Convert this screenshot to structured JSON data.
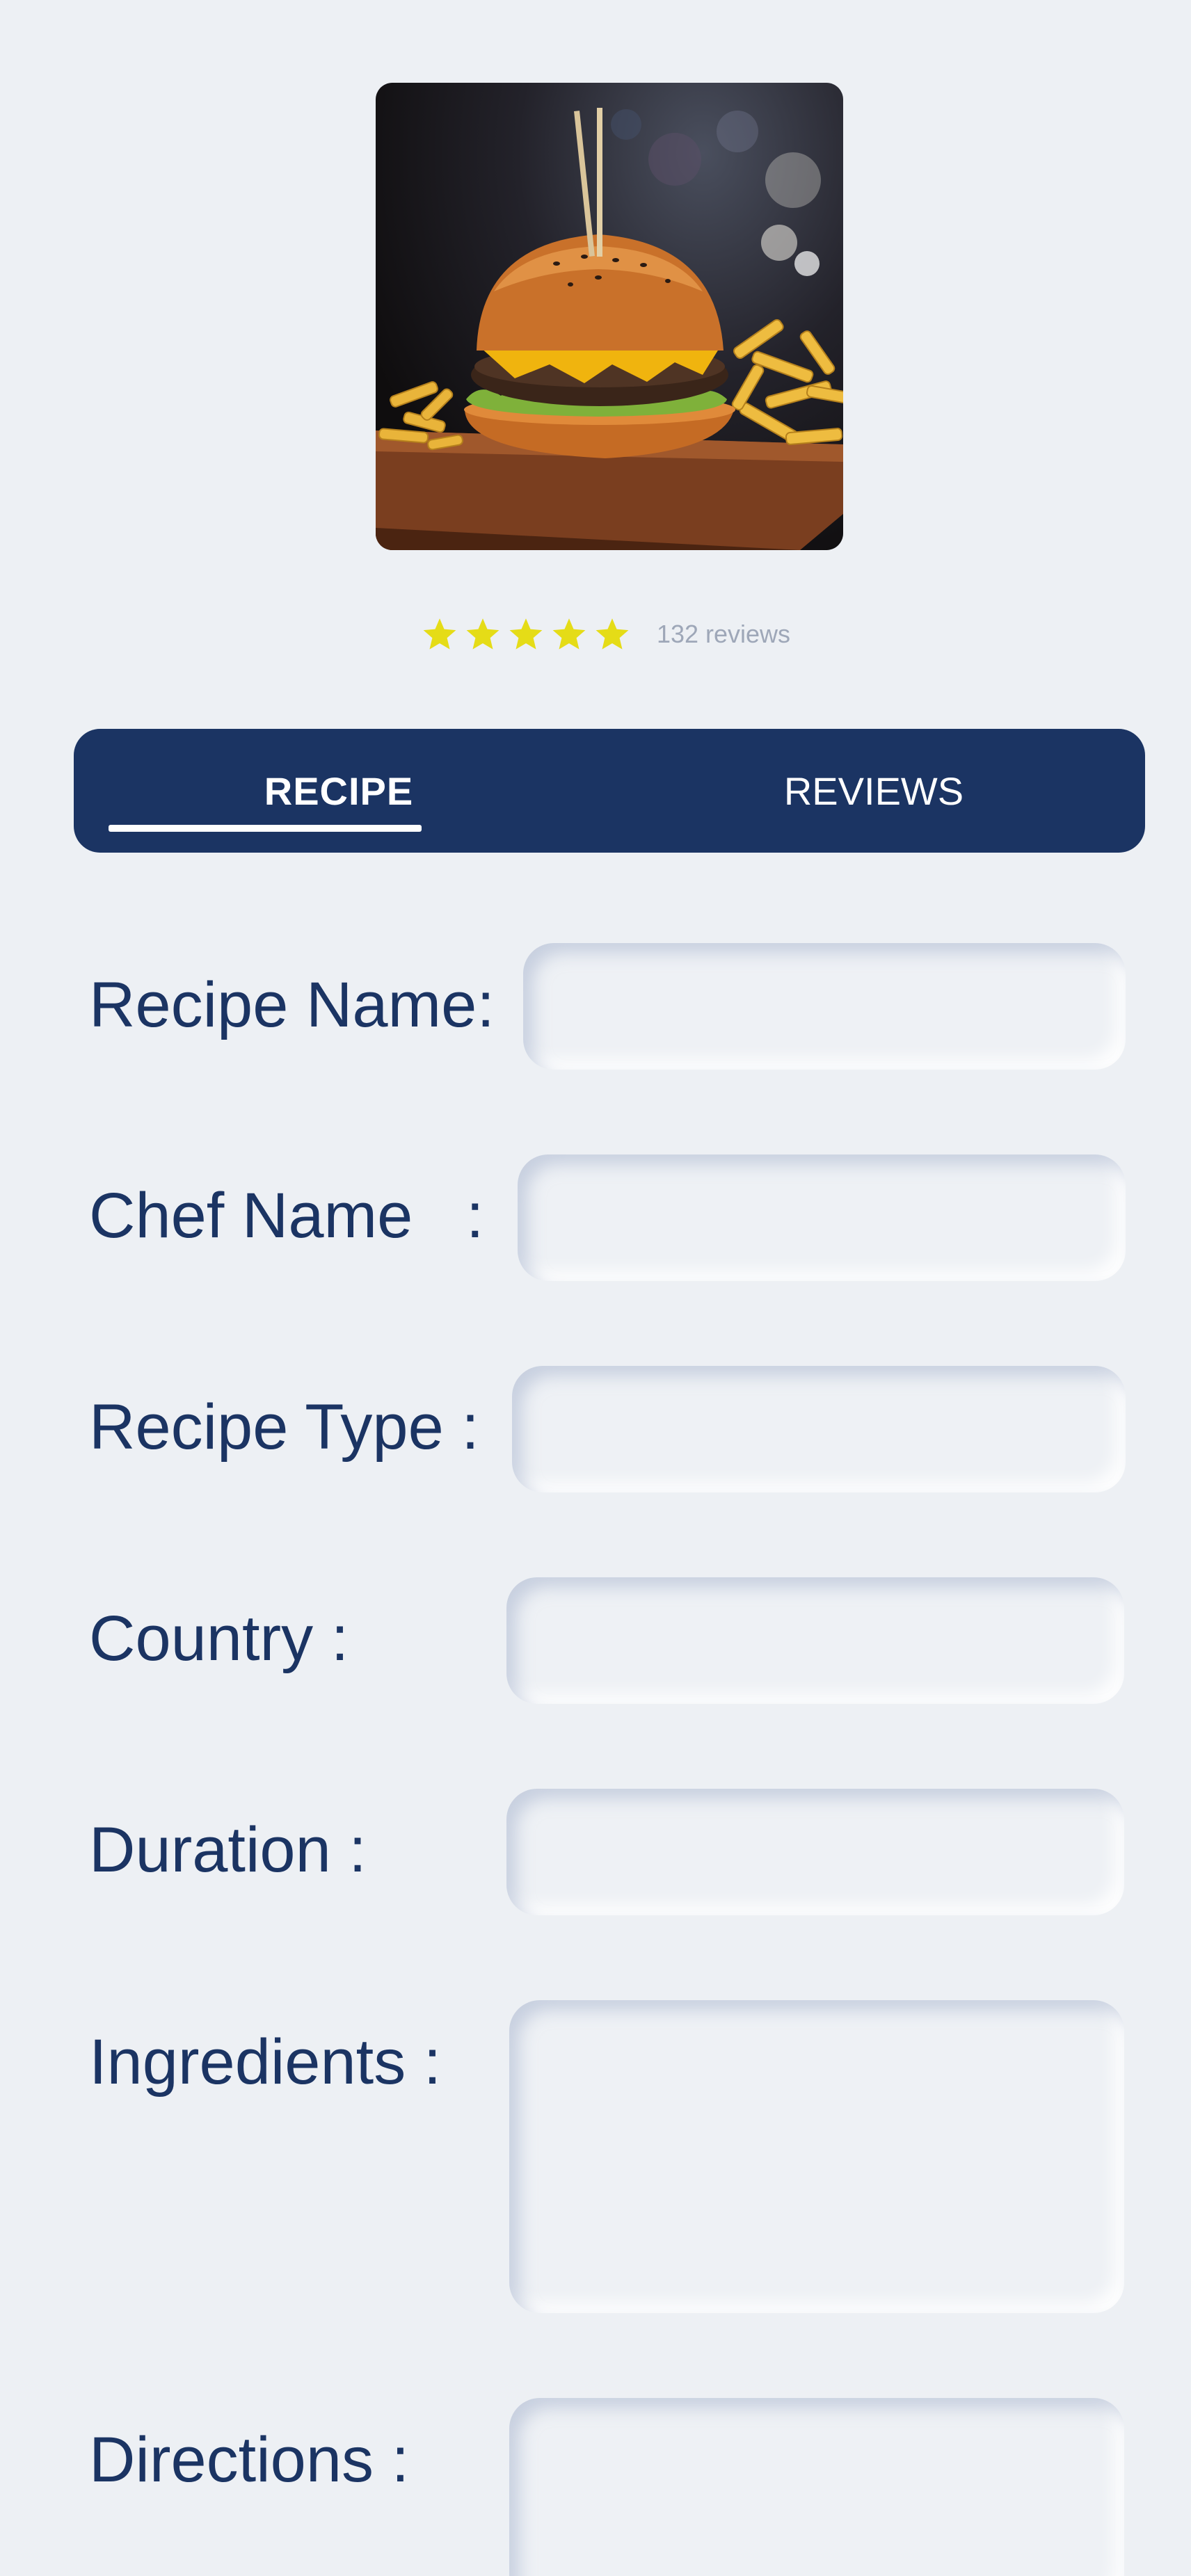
{
  "hero": {
    "alt": "burger with fries"
  },
  "rating": {
    "stars": 5,
    "star_color": "#e5dc17",
    "reviews_label": "132 reviews"
  },
  "tabs": [
    {
      "label": "RECIPE",
      "active": true
    },
    {
      "label": "REVIEWS",
      "active": false
    }
  ],
  "colors": {
    "primary": "#1b3463",
    "background": "#edf0f4",
    "star": "#e5dc17",
    "muted": "#9ea7b8"
  },
  "form": {
    "recipe_name": {
      "label": "Recipe Name:",
      "value": ""
    },
    "chef_name": {
      "label": "Chef Name   :",
      "value": ""
    },
    "recipe_type": {
      "label": "Recipe Type :",
      "value": ""
    },
    "country": {
      "label": "Country :",
      "value": ""
    },
    "duration": {
      "label": "Duration :",
      "value": ""
    },
    "ingredients": {
      "label": "Ingredients :",
      "value": ""
    },
    "directions": {
      "label": "Directions :",
      "value": ""
    }
  }
}
